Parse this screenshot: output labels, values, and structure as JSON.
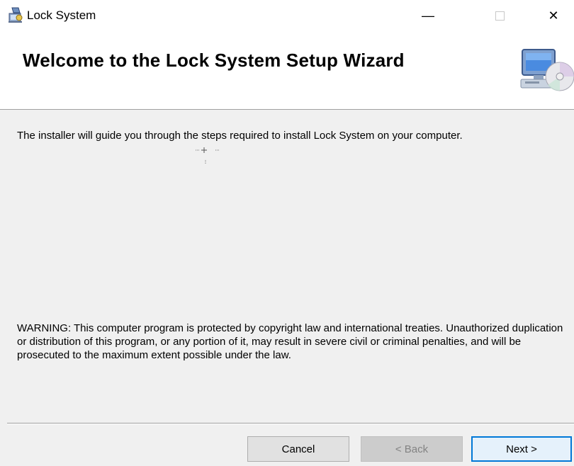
{
  "window": {
    "title": "Lock System",
    "minimize_glyph": "—",
    "maximize_glyph": "☐",
    "close_glyph": "✕"
  },
  "header": {
    "title": "Welcome to the Lock System Setup Wizard",
    "graphic_icon": "computer-cd-icon"
  },
  "body": {
    "intro": "The installer will guide you through the steps required to install Lock System on your computer.",
    "warning": "WARNING: This computer program is protected by copyright law and international treaties. Unauthorized duplication or distribution of this program, or any portion of it, may result in severe civil or criminal penalties, and will be prosecuted to the maximum extent possible under the law."
  },
  "buttons": {
    "cancel": "Cancel",
    "back": "< Back",
    "next": "Next >"
  },
  "colors": {
    "window_bg": "#f0f0f0",
    "header_bg": "#ffffff",
    "focus_border": "#0078d7",
    "disabled_text": "#838383"
  }
}
